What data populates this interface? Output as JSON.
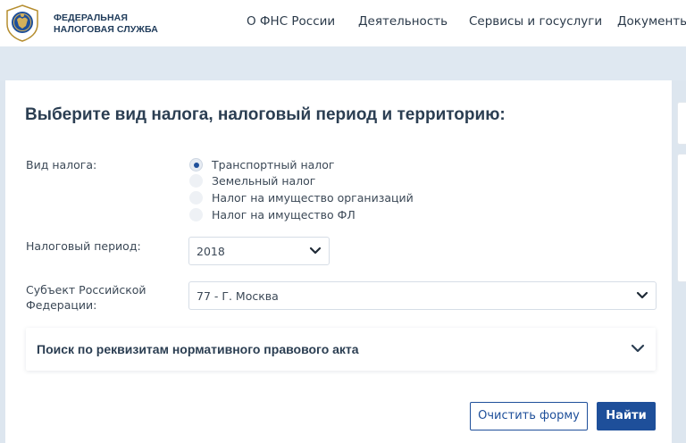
{
  "header": {
    "org_name_line1": "ФЕДЕРАЛЬНАЯ",
    "org_name_line2": "НАЛОГОВАЯ СЛУЖБА",
    "nav": [
      "О ФНС России",
      "Деятельность",
      "Сервисы и госуслуги",
      "Документы"
    ]
  },
  "form": {
    "title": "Выберите вид налога, налоговый период и территорию:",
    "tax_type": {
      "label": "Вид налога:",
      "options": [
        "Транспортный налог",
        "Земельный налог",
        "Налог на имущество организаций",
        "Налог на имущество ФЛ"
      ],
      "selected": "Транспортный налог"
    },
    "period": {
      "label": "Налоговый период:",
      "value": "2018"
    },
    "region": {
      "label_line1": "Субъект Российской",
      "label_line2": "Федерации:",
      "value": "77 - Г. Москва"
    },
    "accordion_title": "Поиск по реквизитам нормативного правового акта",
    "clear_button": "Очистить форму",
    "find_button": "Найти"
  },
  "colors": {
    "accent": "#1e4f9a",
    "page_band": "#dfe8f1",
    "text": "#3b4856"
  }
}
